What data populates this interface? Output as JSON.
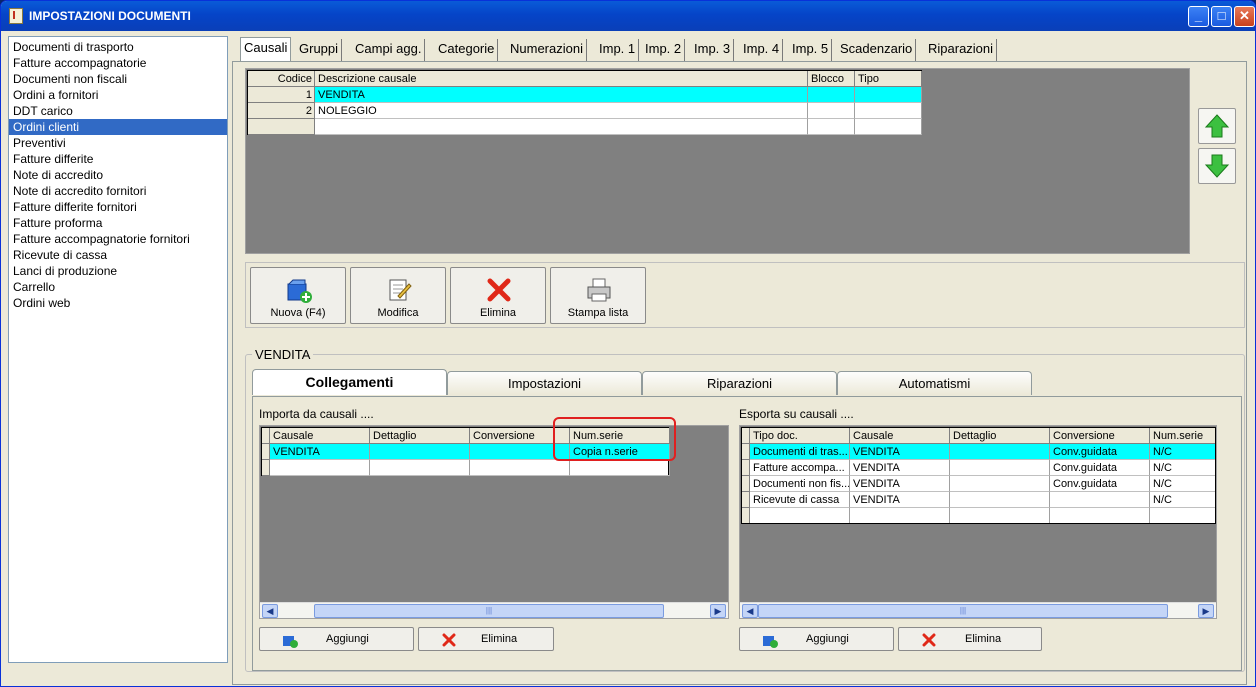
{
  "window": {
    "title": "IMPOSTAZIONI DOCUMENTI",
    "min": "_",
    "max": "□",
    "close": "✕"
  },
  "doc_types": [
    {
      "label": "Documenti di trasporto",
      "selected": false
    },
    {
      "label": "Fatture accompagnatorie",
      "selected": false
    },
    {
      "label": "Documenti non fiscali",
      "selected": false
    },
    {
      "label": "Ordini a fornitori",
      "selected": false
    },
    {
      "label": "DDT carico",
      "selected": false
    },
    {
      "label": "Ordini clienti",
      "selected": true
    },
    {
      "label": "Preventivi",
      "selected": false
    },
    {
      "label": "Fatture differite",
      "selected": false
    },
    {
      "label": "Note di accredito",
      "selected": false
    },
    {
      "label": "Note di accredito fornitori",
      "selected": false
    },
    {
      "label": "Fatture differite fornitori",
      "selected": false
    },
    {
      "label": "Fatture proforma",
      "selected": false
    },
    {
      "label": "Fatture accompagnatorie fornitori",
      "selected": false
    },
    {
      "label": "Ricevute di cassa",
      "selected": false
    },
    {
      "label": "Lanci di produzione",
      "selected": false
    },
    {
      "label": "Carrello",
      "selected": false
    },
    {
      "label": "Ordini web",
      "selected": false
    }
  ],
  "top_tabs": [
    "Causali",
    "Gruppi",
    "Campi agg.",
    "Categorie",
    "Numerazioni",
    "Imp. 1",
    "Imp. 2",
    "Imp. 3",
    "Imp. 4",
    "Imp. 5",
    "Scadenzario",
    "Riparazioni"
  ],
  "causali_grid": {
    "headers": [
      "Codice",
      "Descrizione causale",
      "Blocco",
      "Tipo"
    ],
    "rows": [
      {
        "codice": "1",
        "descrizione": "VENDITA",
        "blocco": "",
        "tipo": "",
        "selected": true
      },
      {
        "codice": "2",
        "descrizione": "NOLEGGIO",
        "blocco": "",
        "tipo": "",
        "selected": false
      }
    ]
  },
  "toolbar": {
    "new": "Nuova (F4)",
    "edit": "Modifica",
    "delete": "Elimina",
    "print": "Stampa lista"
  },
  "group_label": "VENDITA",
  "sub_tabs": [
    "Collegamenti",
    "Impostazioni",
    "Riparazioni",
    "Automatismi"
  ],
  "import_section": {
    "title": "Importa da causali ....",
    "headers": [
      "Causale",
      "Dettaglio",
      "Conversione",
      "Num.serie"
    ],
    "rows": [
      {
        "causale": "VENDITA",
        "dettaglio": "",
        "conversione": "",
        "numserie": "Copia n.serie"
      }
    ],
    "add_label": "Aggiungi",
    "delete_label": "Elimina",
    "scroll_grip": "|||"
  },
  "export_section": {
    "title": "Esporta su causali ....",
    "headers": [
      "Tipo doc.",
      "Causale",
      "Dettaglio",
      "Conversione",
      "Num.serie"
    ],
    "rows": [
      {
        "tipo": "Documenti di tras...",
        "causale": "VENDITA",
        "dettaglio": "",
        "conversione": "Conv.guidata",
        "numserie": "N/C"
      },
      {
        "tipo": "Fatture accompa...",
        "causale": "VENDITA",
        "dettaglio": "",
        "conversione": "Conv.guidata",
        "numserie": "N/C"
      },
      {
        "tipo": "Documenti non fis...",
        "causale": "VENDITA",
        "dettaglio": "",
        "conversione": "Conv.guidata",
        "numserie": "N/C"
      },
      {
        "tipo": "Ricevute di cassa",
        "causale": "VENDITA",
        "dettaglio": "",
        "conversione": "",
        "numserie": "N/C"
      }
    ],
    "add_label": "Aggiungi",
    "delete_label": "Elimina",
    "scroll_grip": "|||"
  },
  "colors": {
    "selection_row": "#00ffff",
    "highlight_box": "#e02020",
    "list_selection": "#316ac5"
  }
}
